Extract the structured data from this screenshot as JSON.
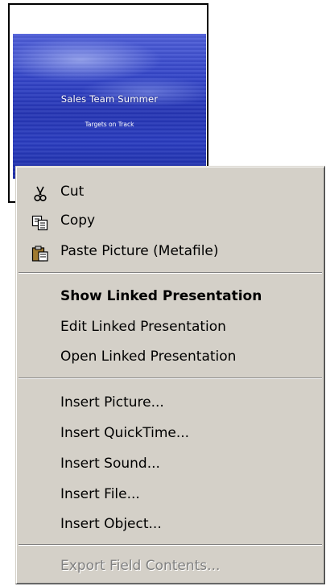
{
  "slide": {
    "title": "Sales Team Summer",
    "subtitle": "Targets on Track"
  },
  "menu": {
    "items": [
      {
        "label": "Cut",
        "icon": "scissors-icon"
      },
      {
        "label": "Copy",
        "icon": "copy-icon"
      },
      {
        "label": "Paste Picture (Metafile)",
        "icon": "paste-icon"
      },
      {
        "label": "Show Linked Presentation",
        "bold": true
      },
      {
        "label": "Edit Linked Presentation"
      },
      {
        "label": "Open Linked Presentation"
      },
      {
        "label": "Insert Picture..."
      },
      {
        "label": "Insert QuickTime..."
      },
      {
        "label": "Insert Sound..."
      },
      {
        "label": "Insert File..."
      },
      {
        "label": "Insert Object..."
      },
      {
        "label": "Export Field Contents...",
        "disabled": true
      }
    ]
  },
  "colors": {
    "menu_background": "#d4d0c8",
    "disabled_text": "#808080",
    "slide_blue": "#2a3dbf"
  }
}
